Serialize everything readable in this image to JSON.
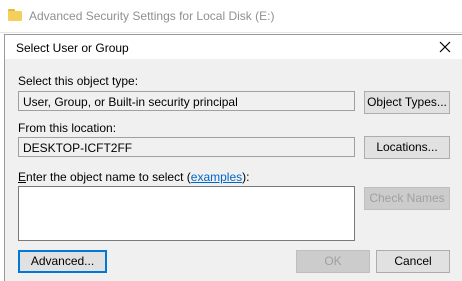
{
  "parent_window": {
    "title": "Advanced Security Settings for Local Disk (E:)",
    "icon": "folder-icon"
  },
  "dialog": {
    "title": "Select User or Group",
    "close_icon": "close-icon",
    "object_type": {
      "label": "Select this object type:",
      "value": "User, Group, or Built-in security principal",
      "button": "Object Types..."
    },
    "location": {
      "label": "From this location:",
      "value": "DESKTOP-ICFT2FF",
      "button": "Locations..."
    },
    "object_name": {
      "label_prefix": "nter the object name to select (",
      "label_accel": "E",
      "link": "examples",
      "label_suffix": "):",
      "value": "",
      "check_button": "Check Names"
    },
    "advanced_button": "Advanced...",
    "ok_button": "OK",
    "cancel_button": "Cancel"
  }
}
